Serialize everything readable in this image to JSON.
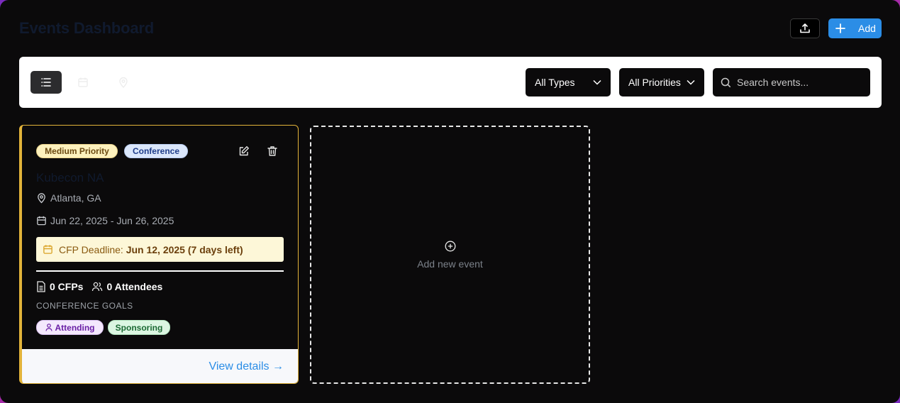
{
  "header": {
    "title": "Events Dashboard",
    "add_label": "Add"
  },
  "filters": {
    "type_selected": "All Types",
    "priority_selected": "All Priorities",
    "search_placeholder": "Search events..."
  },
  "event": {
    "priority_badge": "Medium Priority",
    "type_badge": "Conference",
    "name": "Kubecon NA",
    "location": "Atlanta, GA",
    "dates": "Jun 22, 2025 - Jun 26, 2025",
    "deadline_label": "CFP Deadline:",
    "deadline_value": "Jun 12, 2025 (7 days left)",
    "cfps": "0 CFPs",
    "attendees": "0 Attendees",
    "goals_label": "CONFERENCE GOALS",
    "goals": [
      "Attending",
      "Sponsoring"
    ],
    "view_details": "View details →"
  },
  "add_card": {
    "label": "Add new event"
  },
  "colors": {
    "accent": "#2b8de6",
    "card_border": "#e2b33a",
    "background": "#0b0a0b"
  }
}
